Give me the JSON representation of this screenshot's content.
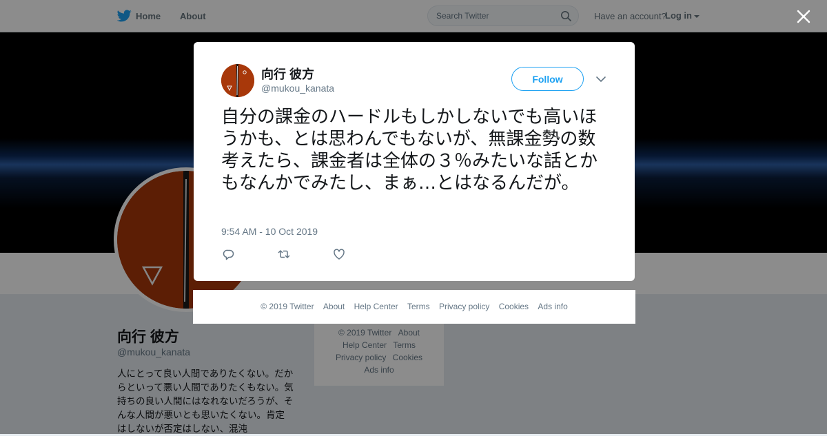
{
  "topnav": {
    "home_label": "Home",
    "about_label": "About",
    "search_placeholder": "Search Twitter",
    "have_account": "Have an account?",
    "login_label": "Log in"
  },
  "profile": {
    "name": "向行 彼方",
    "handle": "@mukou_kanata",
    "bio": "人にとって良い人間でありたくない。だからといって悪い人間でありたくもない。気持ちの良い人間にはなれないだろうが、そんな人間が悪いとも思いたくない。肯定はしないが否定はしない、混沌"
  },
  "side_footer": {
    "rows": [
      [
        "© 2019 Twitter",
        "About"
      ],
      [
        "Help Center",
        "Terms"
      ],
      [
        "Privacy policy",
        "Cookies"
      ],
      [
        "Ads info"
      ]
    ]
  },
  "tweet": {
    "name": "向行 彼方",
    "handle": "@mukou_kanata",
    "follow_label": "Follow",
    "text": "自分の課金のハードルもしかしないでも高いほうかも、とは思わんでもないが、無課金勢の数考えたら、課金者は全体の３％みたいな話とかもなんかでみたし、まぁ…とはなるんだが。",
    "timestamp": "9:54 AM - 10 Oct 2019"
  },
  "modal_footer": {
    "links": [
      "© 2019 Twitter",
      "About",
      "Help Center",
      "Terms",
      "Privacy policy",
      "Cookies",
      "Ads info"
    ]
  },
  "colors": {
    "accent": "#1da1f2",
    "avatar_bg": "#a8380a",
    "secondary_text": "#657786"
  },
  "icons": [
    "twitter-bird-icon",
    "search-icon",
    "close-icon",
    "chevron-down-icon",
    "reply-icon",
    "retweet-icon",
    "like-icon"
  ]
}
